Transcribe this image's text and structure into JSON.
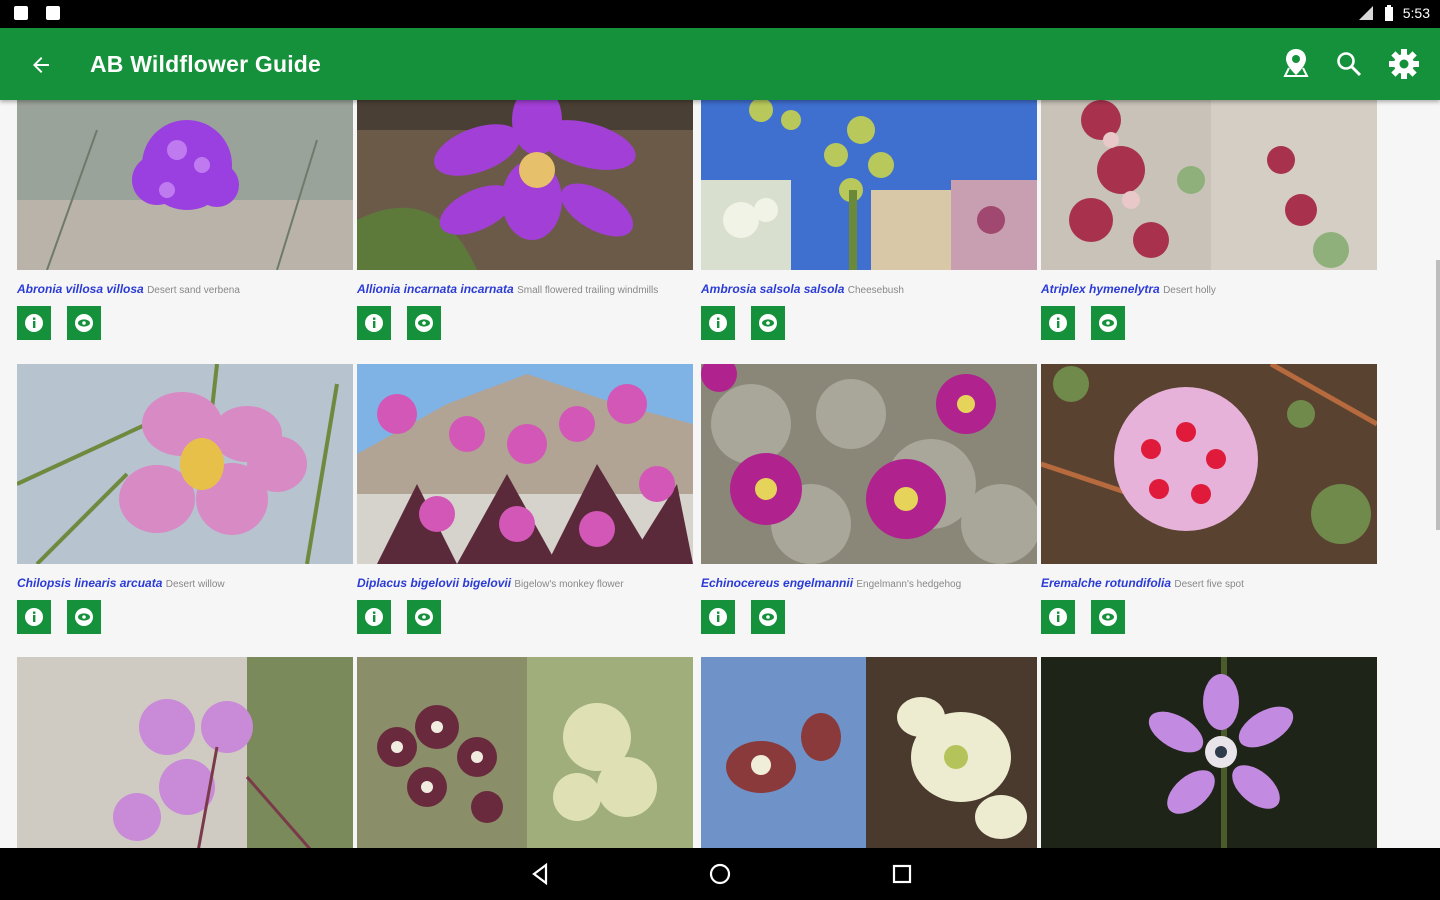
{
  "status": {
    "time": "5:53"
  },
  "app_bar": {
    "title": "AB Wildflower Guide"
  },
  "colors": {
    "accent": "#14913a",
    "scientific_name": "#2b3bd6",
    "common_name": "#888888"
  },
  "icons": {
    "back": "arrow-left-icon",
    "location": "location-pin-icon",
    "search": "search-icon",
    "settings": "gear-icon",
    "info": "info-icon",
    "view": "eye-icon"
  },
  "cards": [
    {
      "scientific": "Abronia villosa villosa",
      "common": "Desert sand verbena"
    },
    {
      "scientific": "Allionia incarnata incarnata",
      "common": "Small flowered trailing windmills"
    },
    {
      "scientific": "Ambrosia salsola salsola",
      "common": "Cheesebush"
    },
    {
      "scientific": "Atriplex hymenelytra",
      "common": "Desert holly"
    },
    {
      "scientific": "Chilopsis linearis arcuata",
      "common": "Desert willow"
    },
    {
      "scientific": "Diplacus bigelovii bigelovii",
      "common": "Bigelow's monkey flower"
    },
    {
      "scientific": "Echinocereus engelmannii",
      "common": "Engelmann's hedgehog"
    },
    {
      "scientific": "Eremalche rotundifolia",
      "common": "Desert five spot"
    },
    {
      "scientific": "",
      "common": ""
    },
    {
      "scientific": "",
      "common": ""
    },
    {
      "scientific": "",
      "common": ""
    },
    {
      "scientific": "",
      "common": ""
    }
  ]
}
